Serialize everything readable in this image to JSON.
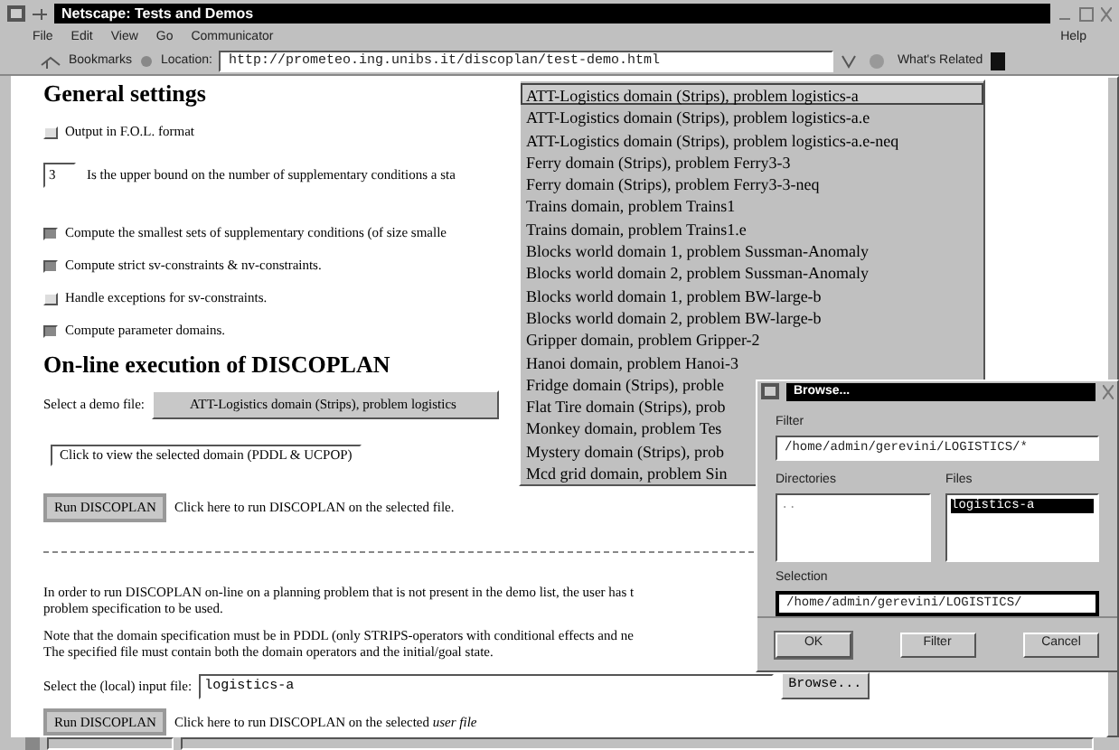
{
  "window": {
    "title": "Netscape: Tests and Demos"
  },
  "menu": [
    "File",
    "Edit",
    "View",
    "Go",
    "Communicator"
  ],
  "menu_right": "Help",
  "toolbar": {
    "bookmarks": "Bookmarks",
    "location_label": "Location:",
    "url": "http://prometeo.ing.unibs.it/discoplan/test-demo.html",
    "whats_related": "What's Related"
  },
  "page": {
    "general_heading": "General settings",
    "options": [
      {
        "kind": "checkbox",
        "label": "Output in F.O.L. format",
        "checked": false
      },
      {
        "kind": "number",
        "value": "3",
        "label": "Is the upper bound on the number of supplementary conditions a sta"
      },
      {
        "kind": "checkbox",
        "label": "Compute the smallest sets of supplementary conditions (of size smalle",
        "checked": true
      },
      {
        "kind": "checkbox",
        "label": "Compute strict sv-constraints & nv-constraints.",
        "checked": true
      },
      {
        "kind": "checkbox",
        "label": "Handle exceptions for sv-constraints.",
        "checked": false
      },
      {
        "kind": "checkbox",
        "label": "Compute parameter domains.",
        "checked": true
      }
    ],
    "online_heading": "On-line execution of DISCOPLAN",
    "demo_label": "Select a demo file:",
    "demo_select": "ATT-Logistics domain (Strips), problem logistics",
    "view_button": "Click to view the selected domain (PDDL & UCPOP)",
    "run_button": "Run DISCOPLAN",
    "run_note": "Click here to run DISCOPLAN on the selected file.",
    "paragraphs": [
      [
        "In order to run DISCOPLAN on-line on a planning problem that is not present in the demo list, the user has t",
        "problem specification to be used."
      ],
      [
        "Note that the domain specification must be in PDDL (only STRIPS-operators with conditional effects and ne",
        "The specified file must contain both the domain operators and the initial/goal state."
      ]
    ],
    "input_label": "Select the (local) input file:",
    "input_value": "logistics-a",
    "browse_button": "Browse...",
    "run_button_2": "Run DISCOPLAN",
    "run_note_2": "Click here to run DISCOPLAN on the selected *user file*"
  },
  "dropdown": {
    "items": [
      {
        "label": "ATT-Logistics domain (Strips), problem logistics-a",
        "selected": true
      },
      {
        "label": "ATT-Logistics domain (Strips), problem logistics-a.e",
        "selected": false
      },
      {
        "label": "ATT-Logistics domain (Strips), problem logistics-a.e-neq",
        "selected": false
      },
      {
        "label": "Ferry domain (Strips), problem Ferry3-3",
        "selected": false
      },
      {
        "label": "Ferry domain (Strips), problem Ferry3-3-neq",
        "selected": false
      },
      {
        "label": "Trains domain, problem Trains1",
        "selected": false
      },
      {
        "label": "Trains domain, problem Trains1.e",
        "selected": false
      },
      {
        "label": "Blocks world domain 1, problem Sussman-Anomaly",
        "selected": false
      },
      {
        "label": "Blocks world domain 2, problem Sussman-Anomaly",
        "selected": false
      },
      {
        "label": "Blocks world domain 1, problem BW-large-b",
        "selected": false
      },
      {
        "label": "Blocks world domain 2, problem BW-large-b",
        "selected": false
      },
      {
        "label": "Gripper domain, problem Gripper-2",
        "selected": false
      },
      {
        "label": "Hanoi domain, problem Hanoi-3",
        "selected": false
      },
      {
        "label": "Fridge domain (Strips), proble",
        "selected": false
      },
      {
        "label": "Flat Tire domain (Strips), prob",
        "selected": false
      },
      {
        "label": "Monkey domain, problem Tes",
        "selected": false
      },
      {
        "label": "Mystery domain (Strips), prob",
        "selected": false
      },
      {
        "label": "Mcd grid domain, problem Sin",
        "selected": false
      }
    ]
  },
  "dialog": {
    "title": "Browse...",
    "filter_label": "Filter",
    "filter_value": "/home/admin/gerevini/LOGISTICS/*",
    "directories_label": "Directories",
    "directories": [
      ".."
    ],
    "files_label": "Files",
    "files": [
      {
        "label": "logistics-a",
        "selected": true
      }
    ],
    "selection_label": "Selection",
    "selection_value": "/home/admin/gerevini/LOGISTICS/",
    "buttons": [
      "OK",
      "Filter",
      "Cancel"
    ]
  }
}
